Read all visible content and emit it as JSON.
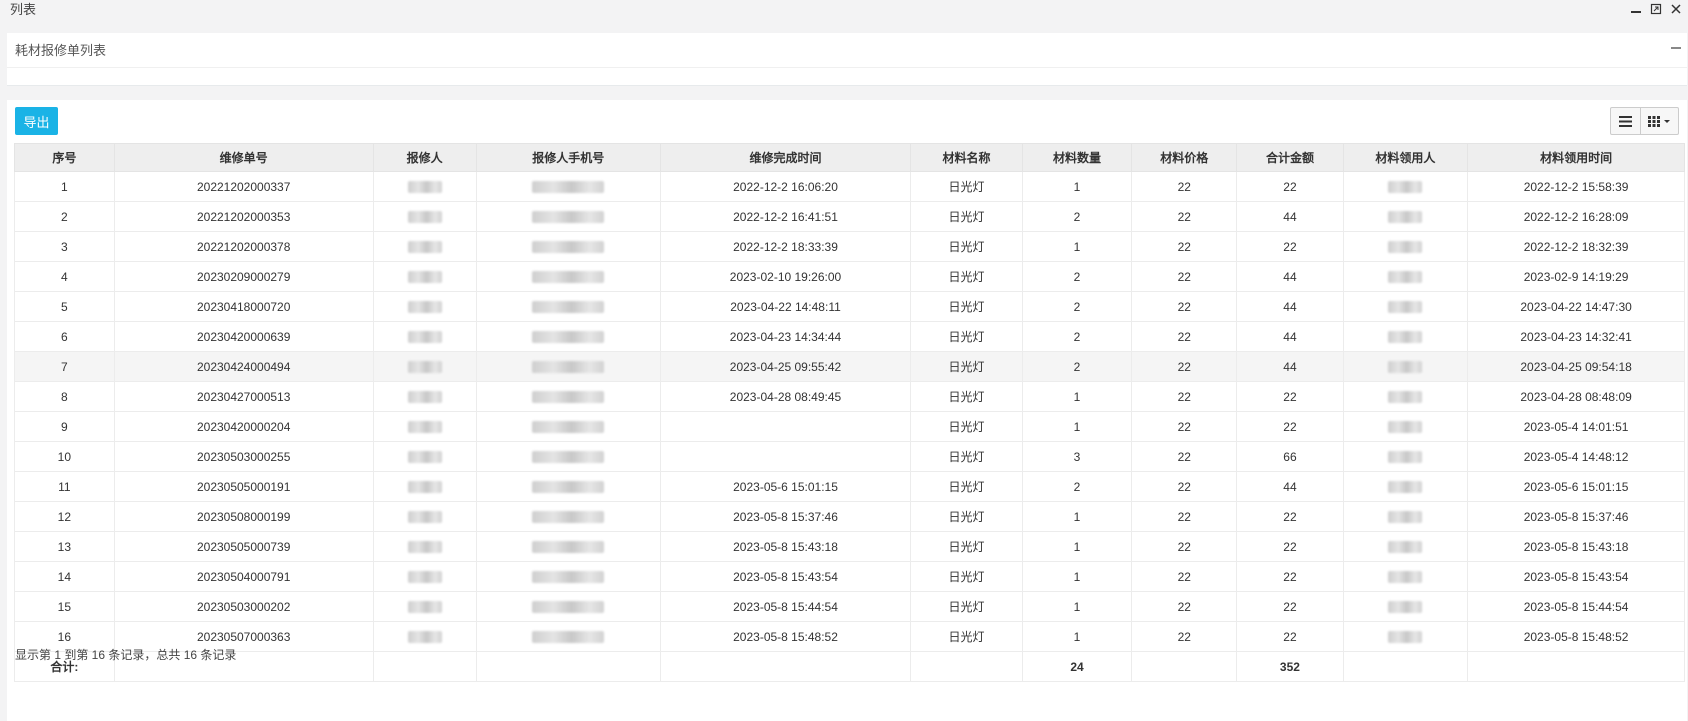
{
  "window": {
    "title": "列表"
  },
  "panel": {
    "title": "耗材报修单列表"
  },
  "toolbar": {
    "export_label": "导出"
  },
  "table": {
    "columns": [
      "序号",
      "维修单号",
      "报修人",
      "报修人手机号",
      "维修完成时间",
      "材料名称",
      "材料数量",
      "材料价格",
      "合计金额",
      "材料领用人",
      "材料领用时间"
    ],
    "rows": [
      [
        "1",
        "20221202000337",
        "",
        "",
        "2022-12-2 16:06:20",
        "日光灯",
        "1",
        "22",
        "22",
        "",
        "2022-12-2 15:58:39"
      ],
      [
        "2",
        "20221202000353",
        "",
        "",
        "2022-12-2 16:41:51",
        "日光灯",
        "2",
        "22",
        "44",
        "",
        "2022-12-2 16:28:09"
      ],
      [
        "3",
        "20221202000378",
        "",
        "",
        "2022-12-2 18:33:39",
        "日光灯",
        "1",
        "22",
        "22",
        "",
        "2022-12-2 18:32:39"
      ],
      [
        "4",
        "20230209000279",
        "",
        "",
        "2023-02-10 19:26:00",
        "日光灯",
        "2",
        "22",
        "44",
        "",
        "2023-02-9 14:19:29"
      ],
      [
        "5",
        "20230418000720",
        "",
        "",
        "2023-04-22 14:48:11",
        "日光灯",
        "2",
        "22",
        "44",
        "",
        "2023-04-22 14:47:30"
      ],
      [
        "6",
        "20230420000639",
        "",
        "",
        "2023-04-23 14:34:44",
        "日光灯",
        "2",
        "22",
        "44",
        "",
        "2023-04-23 14:32:41"
      ],
      [
        "7",
        "20230424000494",
        "",
        "",
        "2023-04-25 09:55:42",
        "日光灯",
        "2",
        "22",
        "44",
        "",
        "2023-04-25 09:54:18"
      ],
      [
        "8",
        "20230427000513",
        "",
        "",
        "2023-04-28 08:49:45",
        "日光灯",
        "1",
        "22",
        "22",
        "",
        "2023-04-28 08:48:09"
      ],
      [
        "9",
        "20230420000204",
        "",
        "",
        "",
        "日光灯",
        "1",
        "22",
        "22",
        "",
        "2023-05-4 14:01:51"
      ],
      [
        "10",
        "20230503000255",
        "",
        "",
        "",
        "日光灯",
        "3",
        "22",
        "66",
        "",
        "2023-05-4 14:48:12"
      ],
      [
        "11",
        "20230505000191",
        "",
        "",
        "2023-05-6 15:01:15",
        "日光灯",
        "2",
        "22",
        "44",
        "",
        "2023-05-6 15:01:15"
      ],
      [
        "12",
        "20230508000199",
        "",
        "",
        "2023-05-8 15:37:46",
        "日光灯",
        "1",
        "22",
        "22",
        "",
        "2023-05-8 15:37:46"
      ],
      [
        "13",
        "20230505000739",
        "",
        "",
        "2023-05-8 15:43:18",
        "日光灯",
        "1",
        "22",
        "22",
        "",
        "2023-05-8 15:43:18"
      ],
      [
        "14",
        "20230504000791",
        "",
        "",
        "2023-05-8 15:43:54",
        "日光灯",
        "1",
        "22",
        "22",
        "",
        "2023-05-8 15:43:54"
      ],
      [
        "15",
        "20230503000202",
        "",
        "",
        "2023-05-8 15:44:54",
        "日光灯",
        "1",
        "22",
        "22",
        "",
        "2023-05-8 15:44:54"
      ],
      [
        "16",
        "20230507000363",
        "",
        "",
        "2023-05-8 15:48:52",
        "日光灯",
        "1",
        "22",
        "22",
        "",
        "2023-05-8 15:48:52"
      ]
    ],
    "footer": [
      "合计:",
      "",
      "",
      "",
      "",
      "",
      "24",
      "",
      "352",
      "",
      ""
    ]
  },
  "pagination": {
    "summary": "显示第 1 到第 16 条记录，总共 16 条记录"
  },
  "colors": {
    "accent": "#1ab3e6",
    "header_bg": "#eeeeee",
    "highlight_row": "#f5f5f5"
  }
}
